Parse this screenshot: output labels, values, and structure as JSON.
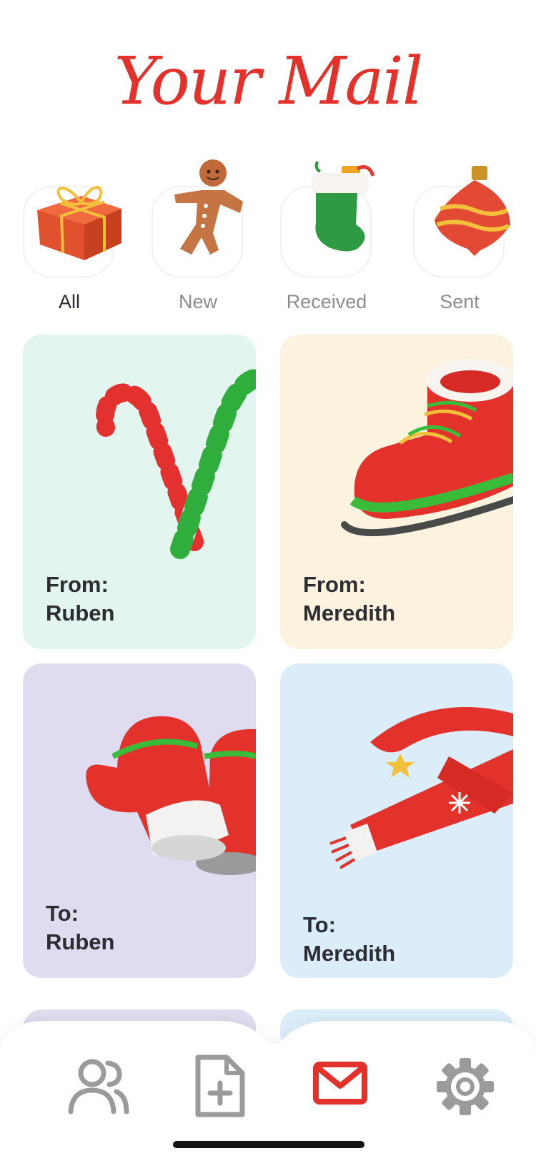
{
  "page": {
    "title": "Your Mail"
  },
  "filters": [
    {
      "label": "All",
      "icon": "gift-icon",
      "active": true
    },
    {
      "label": "New",
      "icon": "gingerbread-icon",
      "active": false
    },
    {
      "label": "Received",
      "icon": "stocking-icon",
      "active": false
    },
    {
      "label": "Sent",
      "icon": "ornament-icon",
      "active": false
    }
  ],
  "cards": [
    {
      "prefix": "From:",
      "name": "Ruben",
      "icon": "candy-cane-icon",
      "color": "#e2f6ef"
    },
    {
      "prefix": "From:",
      "name": "Meredith",
      "icon": "ice-skate-icon",
      "color": "#fbf3dd"
    },
    {
      "prefix": "To:",
      "name": "Ruben",
      "icon": "mittens-icon",
      "color": "#dfdcef"
    },
    {
      "prefix": "To:",
      "name": "Meredith",
      "icon": "scarf-icon",
      "color": "#dbedf9"
    }
  ],
  "nav": [
    {
      "name": "contacts",
      "icon": "people-icon",
      "active": false
    },
    {
      "name": "compose",
      "icon": "new-document-icon",
      "active": false
    },
    {
      "name": "mail",
      "icon": "mail-icon",
      "active": true
    },
    {
      "name": "settings",
      "icon": "gear-icon",
      "active": false
    }
  ],
  "colors": {
    "accent": "#e3312b",
    "inactive": "#9b9b9b"
  }
}
